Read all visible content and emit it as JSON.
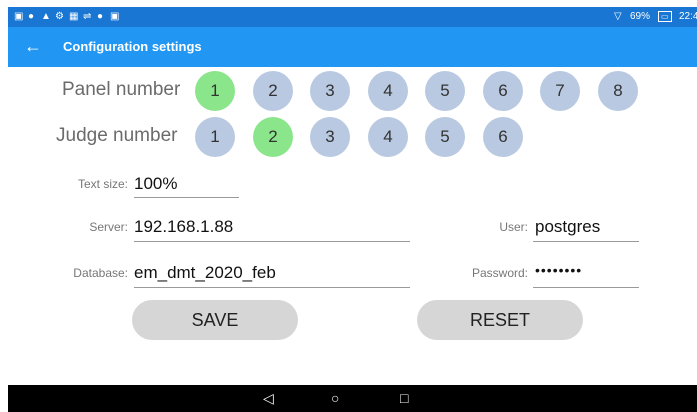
{
  "status_bar": {
    "battery_percent": "69%",
    "time": "22:4",
    "left_icons": [
      "notification-icon",
      "location-icon",
      "warning-icon",
      "settings-icon",
      "calendar-icon",
      "usb-icon",
      "location-icon",
      "photo-icon"
    ]
  },
  "app_bar": {
    "title": "Configuration settings",
    "back_icon": "arrow-left-icon",
    "color": "#2196f3"
  },
  "panel": {
    "label": "Panel number",
    "options": [
      "1",
      "2",
      "3",
      "4",
      "5",
      "6",
      "7",
      "8"
    ],
    "selected": "1"
  },
  "judge": {
    "label": "Judge number",
    "options": [
      "1",
      "2",
      "3",
      "4",
      "5",
      "6"
    ],
    "selected": "2"
  },
  "fields": {
    "text_size": {
      "label": "Text size:",
      "value": "100%"
    },
    "server": {
      "label": "Server:",
      "value": "192.168.1.88"
    },
    "user": {
      "label": "User:",
      "value": "postgres"
    },
    "database": {
      "label": "Database:",
      "value": "em_dmt_2020_feb"
    },
    "password": {
      "label": "Password:",
      "value": "••••••••"
    }
  },
  "buttons": {
    "save": "SAVE",
    "reset": "RESET"
  },
  "colors": {
    "selected": "#8be58b",
    "unselected": "#b8c9e1",
    "button": "#d6d6d6"
  }
}
